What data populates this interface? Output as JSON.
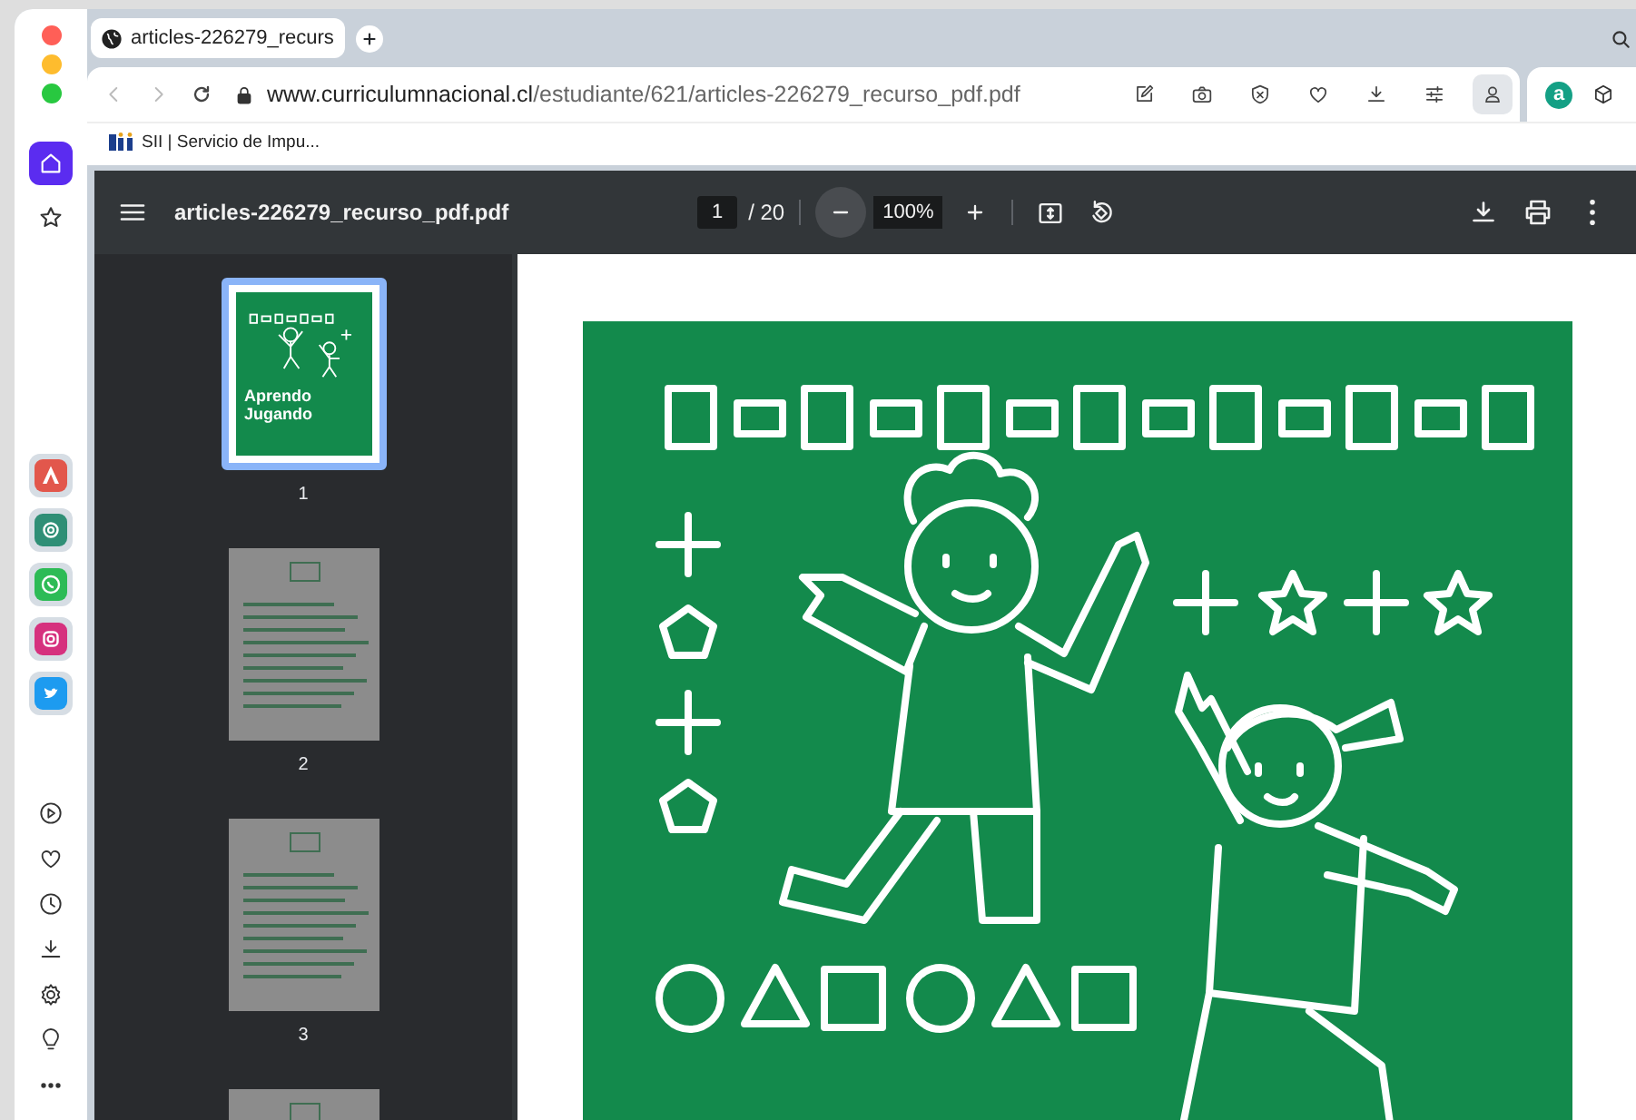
{
  "browser": {
    "tab": {
      "title": "articles-226279_recurs",
      "selected": true
    },
    "url_host": "www.curriculumnacional.cl",
    "url_path": "/estudiante/621/articles-226279_recurso_pdf.pdf",
    "toolbar_icons": [
      {
        "kind": "edit",
        "highlighted": false
      },
      {
        "kind": "camera",
        "highlighted": false
      },
      {
        "kind": "shield",
        "highlighted": false
      },
      {
        "kind": "heart",
        "highlighted": false
      },
      {
        "kind": "download",
        "highlighted": false
      },
      {
        "kind": "sliders",
        "highlighted": false
      },
      {
        "kind": "person",
        "highlighted": true
      }
    ],
    "extensions": [
      {
        "kind": "letter",
        "label": "a"
      },
      {
        "kind": "cube"
      }
    ],
    "bookmarks": [
      {
        "label": "SII | Servicio de Impu..."
      }
    ]
  },
  "sidebar": {
    "top": [
      {
        "kind": "home",
        "selected": true
      },
      {
        "kind": "star",
        "selected": false
      }
    ],
    "apps": [
      {
        "kind": "triangle"
      },
      {
        "kind": "knot"
      },
      {
        "kind": "phone"
      },
      {
        "kind": "camera"
      },
      {
        "kind": "bird"
      }
    ],
    "bottom": [
      {
        "kind": "play"
      },
      {
        "kind": "heart"
      },
      {
        "kind": "clock"
      },
      {
        "kind": "download"
      },
      {
        "kind": "gear"
      },
      {
        "kind": "bulb"
      },
      {
        "kind": "more"
      }
    ]
  },
  "pdf": {
    "title": "articles-226279_recurso_pdf.pdf",
    "page": "1",
    "page_count": "/ 20",
    "zoom": "100%",
    "thumbnails": [
      {
        "kind": "cover",
        "label": "1",
        "selected": true,
        "cover_title": "Aprendo Jugando"
      },
      {
        "kind": "text",
        "label": "2",
        "selected": false
      },
      {
        "kind": "text",
        "label": "3",
        "selected": false
      },
      {
        "kind": "text",
        "selected": false
      }
    ]
  }
}
